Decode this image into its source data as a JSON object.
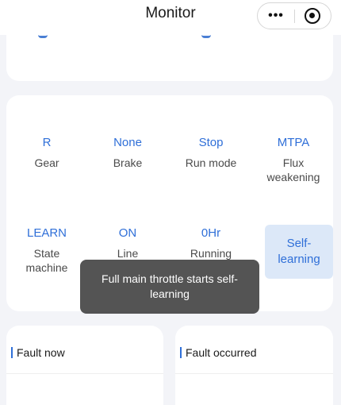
{
  "header": {
    "title": "Monitor"
  },
  "params": [
    {
      "value": "R",
      "label": "Gear"
    },
    {
      "value": "None",
      "label": "Brake"
    },
    {
      "value": "Stop",
      "label": "Run mode"
    },
    {
      "value": "MTPA",
      "label": "Flux weakening"
    },
    {
      "value": "LEARN",
      "label": "State machine"
    },
    {
      "value": "ON",
      "label": "Line"
    },
    {
      "value": "0Hr",
      "label": "Running"
    }
  ],
  "self_learning_button": "Self-learning",
  "toast": "Full main throttle starts self-learning",
  "fault_now": {
    "title": "Fault now"
  },
  "fault_occurred": {
    "title": "Fault occurred"
  },
  "colors": {
    "accent": "#2f6fd8",
    "background": "#f3f4f8"
  }
}
